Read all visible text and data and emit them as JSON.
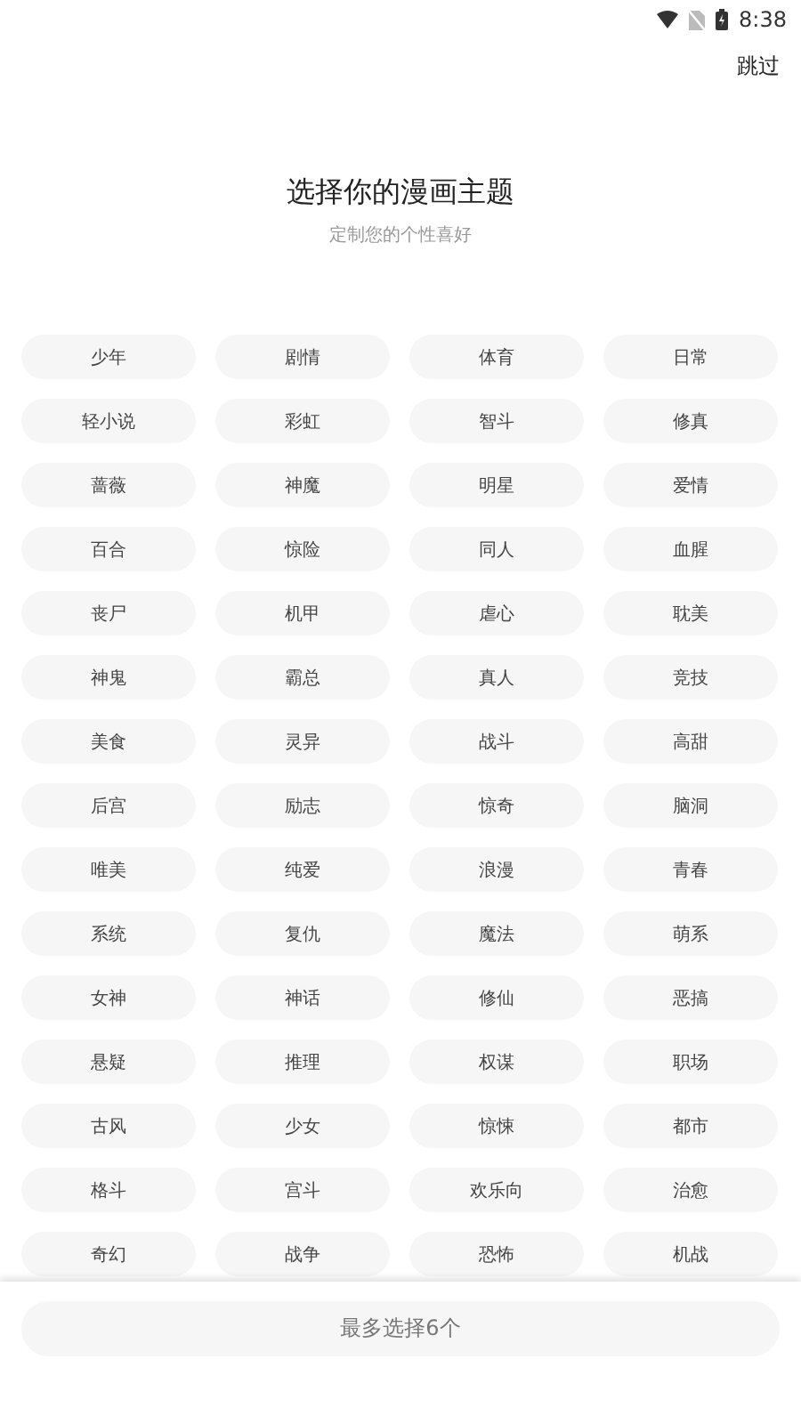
{
  "status_bar": {
    "time": "8:38"
  },
  "header": {
    "skip": "跳过",
    "title": "选择你的漫画主题",
    "subtitle": "定制您的个性喜好"
  },
  "tags": [
    {
      "label": "少年",
      "selected": false
    },
    {
      "label": "剧情",
      "selected": false
    },
    {
      "label": "体育",
      "selected": false
    },
    {
      "label": "日常",
      "selected": false
    },
    {
      "label": "轻小说",
      "selected": false
    },
    {
      "label": "彩虹",
      "selected": false
    },
    {
      "label": "智斗",
      "selected": false
    },
    {
      "label": "修真",
      "selected": false
    },
    {
      "label": "蔷薇",
      "selected": false
    },
    {
      "label": "神魔",
      "selected": false
    },
    {
      "label": "明星",
      "selected": false
    },
    {
      "label": "爱情",
      "selected": false
    },
    {
      "label": "百合",
      "selected": false
    },
    {
      "label": "惊险",
      "selected": false
    },
    {
      "label": "同人",
      "selected": false
    },
    {
      "label": "血腥",
      "selected": false
    },
    {
      "label": "丧尸",
      "selected": false
    },
    {
      "label": "机甲",
      "selected": false
    },
    {
      "label": "虐心",
      "selected": false
    },
    {
      "label": "耽美",
      "selected": false
    },
    {
      "label": "神鬼",
      "selected": false
    },
    {
      "label": "霸总",
      "selected": false
    },
    {
      "label": "真人",
      "selected": false
    },
    {
      "label": "竞技",
      "selected": false
    },
    {
      "label": "美食",
      "selected": false
    },
    {
      "label": "灵异",
      "selected": false
    },
    {
      "label": "战斗",
      "selected": false
    },
    {
      "label": "高甜",
      "selected": false
    },
    {
      "label": "后宫",
      "selected": false
    },
    {
      "label": "励志",
      "selected": false
    },
    {
      "label": "惊奇",
      "selected": false
    },
    {
      "label": "脑洞",
      "selected": false
    },
    {
      "label": "唯美",
      "selected": false
    },
    {
      "label": "纯爱",
      "selected": false
    },
    {
      "label": "浪漫",
      "selected": false
    },
    {
      "label": "青春",
      "selected": false
    },
    {
      "label": "系统",
      "selected": false
    },
    {
      "label": "复仇",
      "selected": false
    },
    {
      "label": "魔法",
      "selected": false
    },
    {
      "label": "萌系",
      "selected": false
    },
    {
      "label": "女神",
      "selected": false
    },
    {
      "label": "神话",
      "selected": false
    },
    {
      "label": "修仙",
      "selected": false
    },
    {
      "label": "恶搞",
      "selected": false
    },
    {
      "label": "悬疑",
      "selected": false
    },
    {
      "label": "推理",
      "selected": false
    },
    {
      "label": "权谋",
      "selected": false
    },
    {
      "label": "职场",
      "selected": false
    },
    {
      "label": "古风",
      "selected": false
    },
    {
      "label": "少女",
      "selected": false
    },
    {
      "label": "惊悚",
      "selected": false
    },
    {
      "label": "都市",
      "selected": false
    },
    {
      "label": "格斗",
      "selected": false
    },
    {
      "label": "宫斗",
      "selected": false
    },
    {
      "label": "欢乐向",
      "selected": false
    },
    {
      "label": "治愈",
      "selected": false
    },
    {
      "label": "奇幻",
      "selected": false
    },
    {
      "label": "战争",
      "selected": false
    },
    {
      "label": "恐怖",
      "selected": false
    },
    {
      "label": "机战",
      "selected": false
    }
  ],
  "footer": {
    "button": "最多选择6个"
  }
}
